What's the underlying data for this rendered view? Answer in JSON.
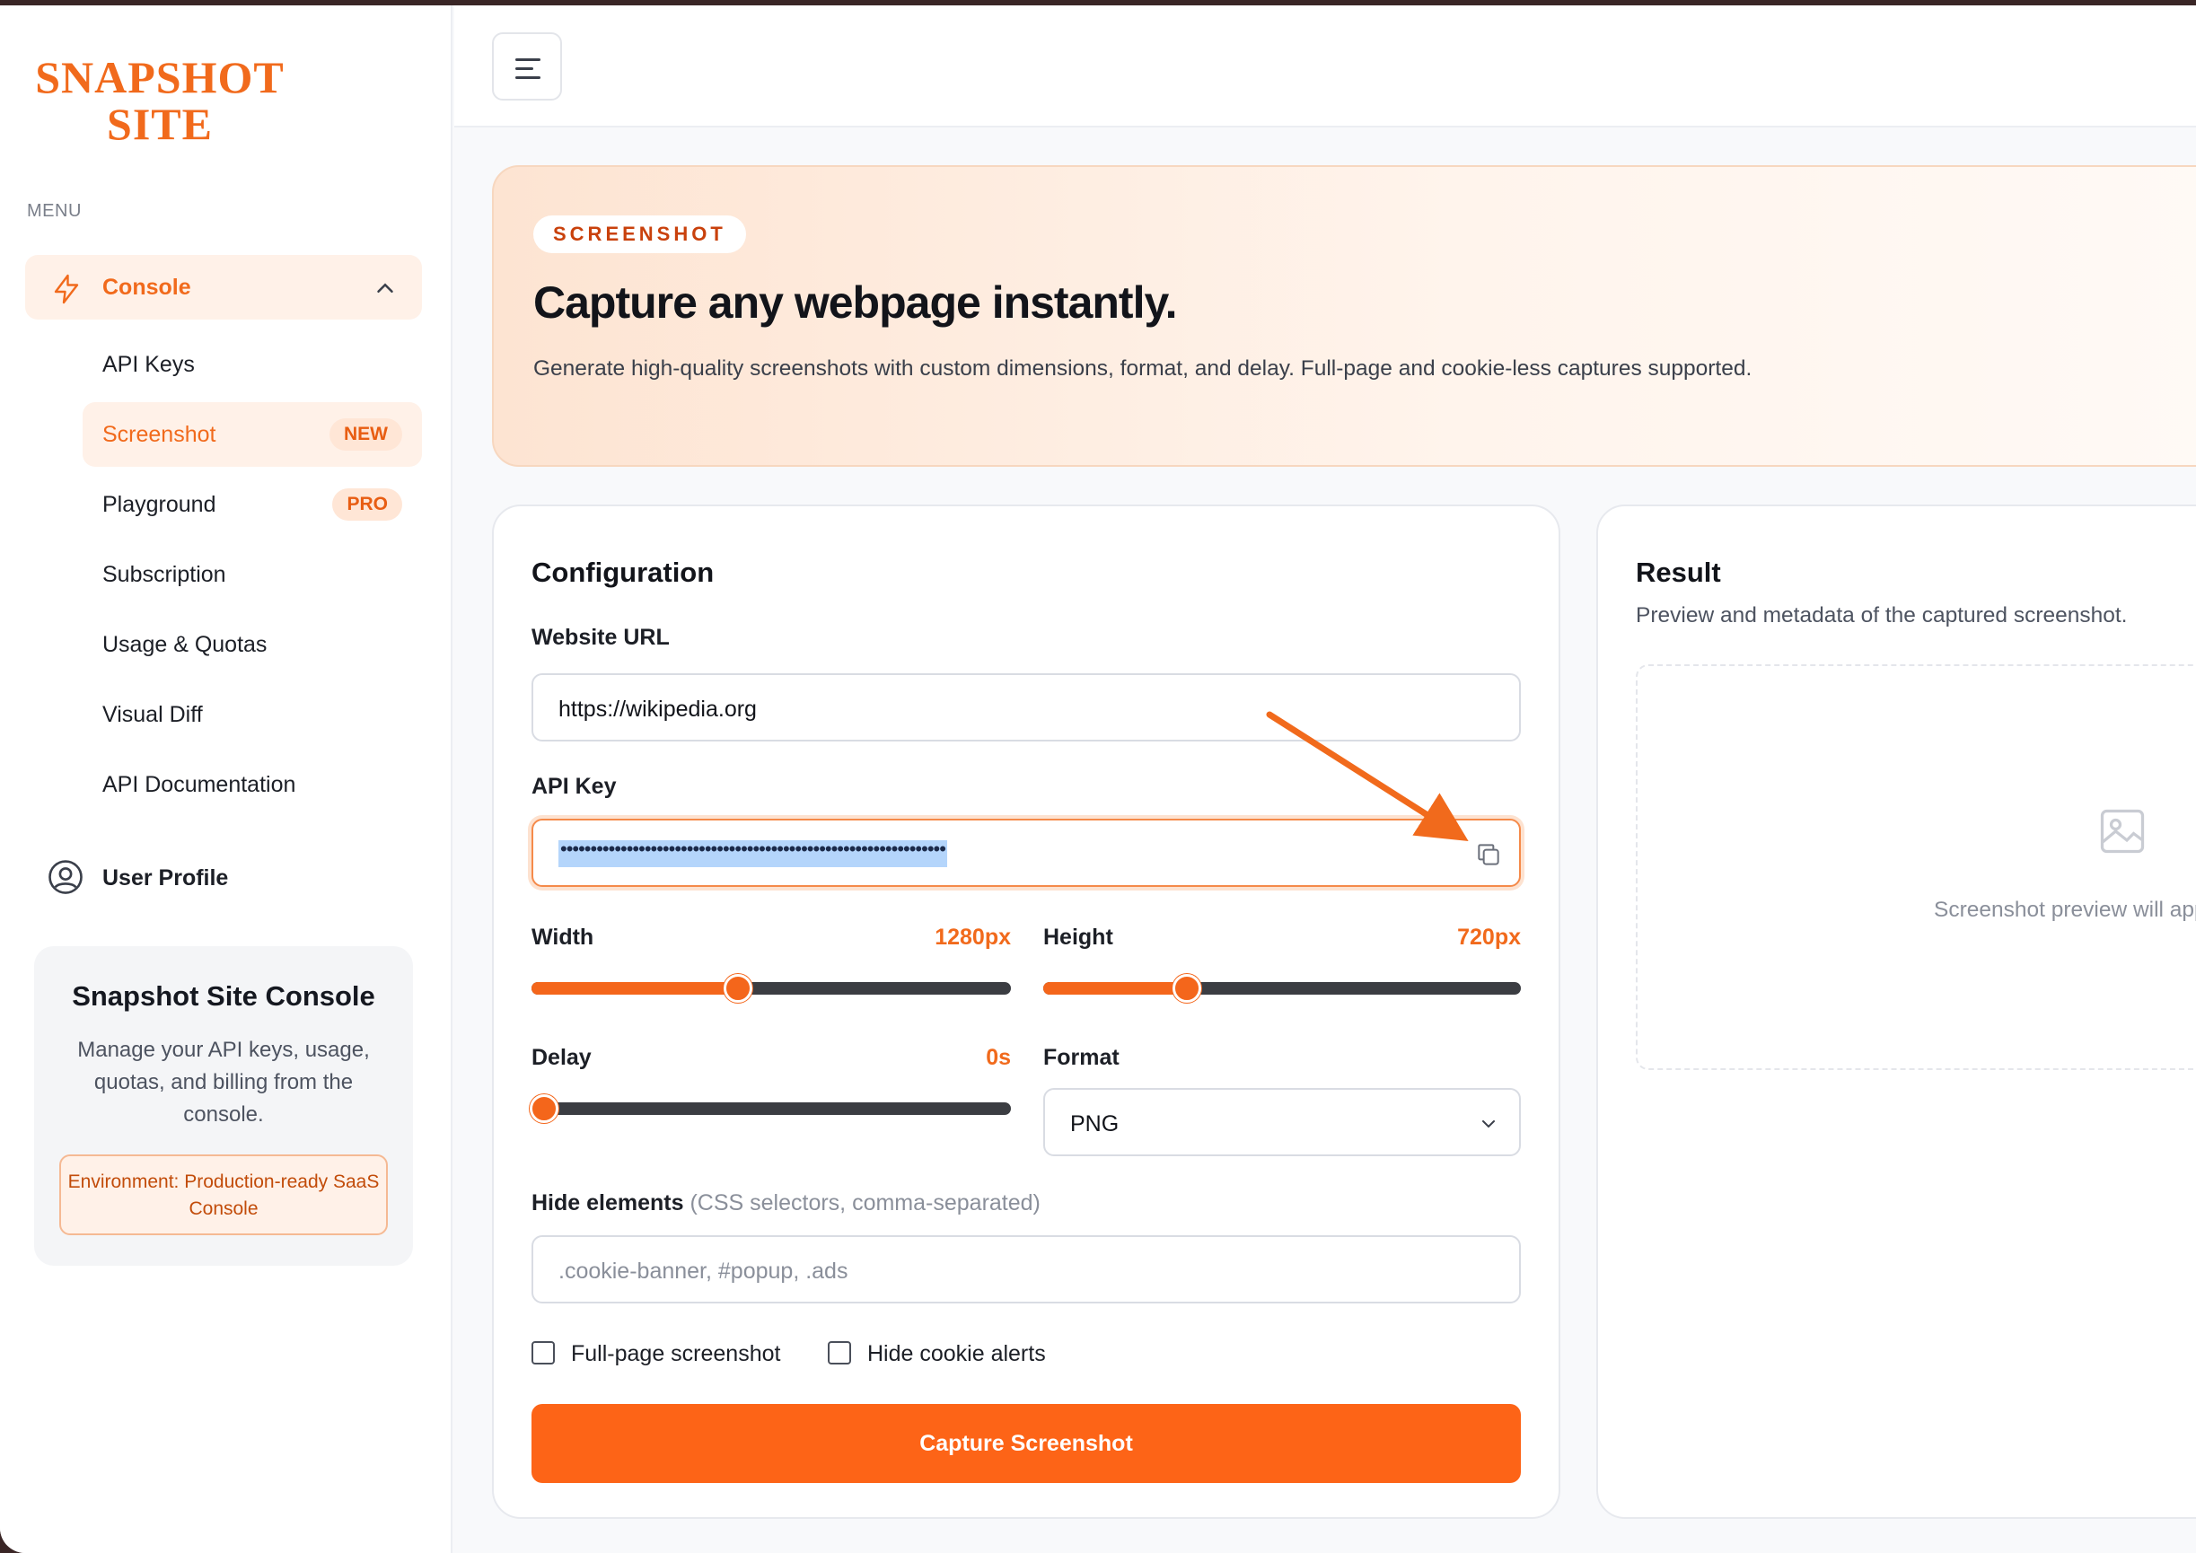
{
  "app": {
    "logo_line1": "SNAPSHOT",
    "logo_line2": "SITE"
  },
  "sidebar": {
    "menu_label": "MENU",
    "console": {
      "label": "Console",
      "icon": "bolt-icon"
    },
    "items": [
      {
        "label": "API Keys",
        "badge": ""
      },
      {
        "label": "Screenshot",
        "badge": "NEW"
      },
      {
        "label": "Playground",
        "badge": "PRO"
      },
      {
        "label": "Subscription",
        "badge": ""
      },
      {
        "label": "Usage & Quotas",
        "badge": ""
      },
      {
        "label": "Visual Diff",
        "badge": ""
      },
      {
        "label": "API Documentation",
        "badge": ""
      }
    ],
    "profile_label": "User Profile",
    "info_card": {
      "title": "Snapshot Site Console",
      "description": "Manage your API keys, usage, quotas, and billing from the console.",
      "environment": "Environment: Production-ready SaaS Console"
    }
  },
  "hero": {
    "tag": "SCREENSHOT",
    "title": "Capture any webpage instantly.",
    "description": "Generate high-quality screenshots with custom dimensions, format, and delay. Full-page and cookie-less captures supported."
  },
  "config": {
    "title": "Configuration",
    "url_label": "Website URL",
    "url_value": "https://wikipedia.org",
    "api_key_label": "API Key",
    "api_key_masked": "••••••••••••••••••••••••••••••••••••••••••••••••••••••••••••••••",
    "width_label": "Width",
    "width_value": "1280px",
    "width_fraction": 0.43,
    "height_label": "Height",
    "height_value": "720px",
    "height_fraction": 0.3,
    "delay_label": "Delay",
    "delay_value": "0s",
    "delay_fraction": 0.0,
    "format_label": "Format",
    "format_value": "PNG",
    "hide_label": "Hide elements",
    "hide_hint": "(CSS selectors, comma-separated)",
    "hide_placeholder": ".cookie-banner, #popup, .ads",
    "fullpage_label": "Full-page screenshot",
    "cookie_label": "Hide cookie alerts",
    "capture_label": "Capture Screenshot"
  },
  "result": {
    "title": "Result",
    "subtitle": "Preview and metadata of the captured screenshot.",
    "placeholder_text": "Screenshot preview will appear here"
  },
  "colors": {
    "accent": "#fd6417",
    "accent_light": "#fff1e8",
    "track": "#3b3d42"
  }
}
